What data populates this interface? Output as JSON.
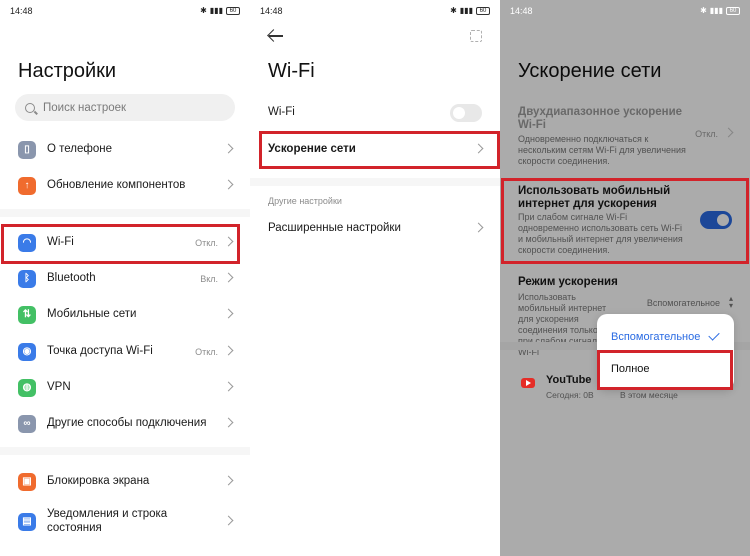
{
  "status": {
    "time": "14:48",
    "battery": "60"
  },
  "panel1": {
    "title": "Настройки",
    "search_placeholder": "Поиск настроек",
    "items": [
      {
        "label": "О телефоне",
        "value": "",
        "icon": "phone-icon",
        "color": "#8a96ad"
      },
      {
        "label": "Обновление компонентов",
        "value": "",
        "icon": "update-arrow-icon",
        "color": "#f06b2e"
      },
      {
        "label": "Wi-Fi",
        "value": "Откл.",
        "icon": "wifi-icon",
        "color": "#3a7be8"
      },
      {
        "label": "Bluetooth",
        "value": "Вкл.",
        "icon": "bluetooth-icon",
        "color": "#3a7be8"
      },
      {
        "label": "Мобильные сети",
        "value": "",
        "icon": "mobile-network-icon",
        "color": "#43c065"
      },
      {
        "label": "Точка доступа Wi-Fi",
        "value": "Откл.",
        "icon": "hotspot-icon",
        "color": "#3a7be8"
      },
      {
        "label": "VPN",
        "value": "",
        "icon": "vpn-globe-icon",
        "color": "#43c065"
      },
      {
        "label": "Другие способы подключения",
        "value": "",
        "icon": "link-icon",
        "color": "#8a96ad"
      },
      {
        "label": "Блокировка экрана",
        "value": "",
        "icon": "lock-icon",
        "color": "#f06b2e"
      },
      {
        "label": "Уведомления и строка",
        "label2": "состояния",
        "value": "",
        "icon": "notification-icon",
        "color": "#3a7be8"
      }
    ]
  },
  "panel2": {
    "title": "Wi-Fi",
    "wifi_label": "Wi-Fi",
    "accel_label": "Ускорение сети",
    "other_caption": "Другие настройки",
    "advanced_label": "Расширенные настройки"
  },
  "panel3": {
    "title": "Ускорение сети",
    "dual_title_1": "Двухдиапазонное ускорение",
    "dual_title_2": "Wi-Fi",
    "dual_desc": "Одновременно подключаться к нескольким сетям Wi-Fi для увеличения скорости соединения.",
    "dual_value": "Откл.",
    "mobile_title_1": "Использовать мобильный",
    "mobile_title_2": "интернет для ускорения",
    "mobile_desc": "При слабом сигнале Wi-Fi одновременно использовать сеть Wi-Fi и мобильный интернет для увеличения скорости соединения.",
    "mode_title": "Режим ускорения",
    "mode_desc": "Использовать мобильный интернет для ускорения соединения только при слабом сигнале Wi-Fi",
    "mode_value": "Вспомогательное",
    "app_name": "YouTube",
    "app_today": "Сегодня: 0В",
    "app_month": "В этом месяце",
    "options": [
      "Вспомогательное",
      "Полное"
    ],
    "selected_option": "Вспомогательное"
  },
  "colors": {
    "accent": "#2a6be3",
    "highlight": "#d2232a"
  }
}
